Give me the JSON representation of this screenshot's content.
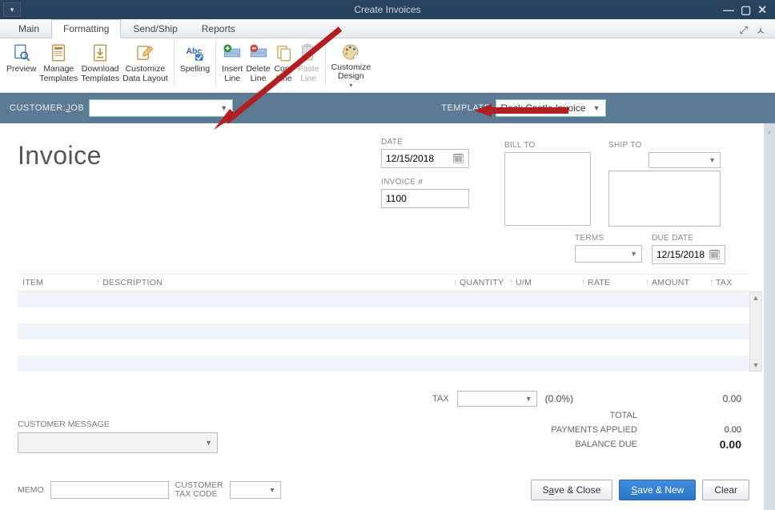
{
  "window": {
    "title": "Create Invoices"
  },
  "tabs": {
    "main": "Main",
    "formatting": "Formatting",
    "sendship": "Send/Ship",
    "reports": "Reports"
  },
  "ribbon": {
    "preview": "Preview",
    "manage_templates": "Manage\nTemplates",
    "download_templates": "Download\nTemplates",
    "customize_data_layout": "Customize\nData Layout",
    "spelling": "Spelling",
    "insert_line": "Insert\nLine",
    "delete_line": "Delete\nLine",
    "copy_line": "Copy\nLine",
    "paste_line": "Paste\nLine",
    "customize_design": "Customize\nDesign"
  },
  "selector": {
    "customer_label_pre": "CUSTOMER:",
    "customer_label_u": "J",
    "customer_label_post": "OB",
    "template_label_pre": "TEMPLA",
    "template_label_u": "T",
    "template_label_post": "E",
    "template_value": "Rock Castle Invoice"
  },
  "doc": {
    "title": "Invoice",
    "date_label": "DATE",
    "date_value": "12/15/2018",
    "invoice_no_label": "INVOICE #",
    "invoice_no_value": "1100",
    "billto_label": "BILL TO",
    "shipto_label": "SHIP TO",
    "terms_label": "TERMS",
    "duedate_label": "DUE DATE",
    "duedate_value": "12/15/2018"
  },
  "grid": {
    "headers": {
      "item": "ITEM",
      "description": "DESCRIPTION",
      "quantity": "QUANTITY",
      "um": "U/M",
      "rate": "RATE",
      "amount": "AMOUNT",
      "tax": "TAX"
    }
  },
  "tax": {
    "label": "TAX",
    "percent": "(0.0%)",
    "value": "0.00"
  },
  "totals": {
    "total_label": "TOTAL",
    "payments_label": "PAYMENTS APPLIED",
    "payments_value": "0.00",
    "balance_label": "BALANCE DUE",
    "balance_value": "0.00"
  },
  "bottom": {
    "customer_message_label": "CUSTOMER MESSAGE",
    "memo_label": "MEMO",
    "customer_tax_code_label": "CUSTOMER\nTAX CODE"
  },
  "buttons": {
    "save_close_pre": "S",
    "save_close_u": "a",
    "save_close_post": "ve & Close",
    "save_new_pre": "",
    "save_new_u": "S",
    "save_new_post": "ave & New",
    "clear": "Clear"
  }
}
